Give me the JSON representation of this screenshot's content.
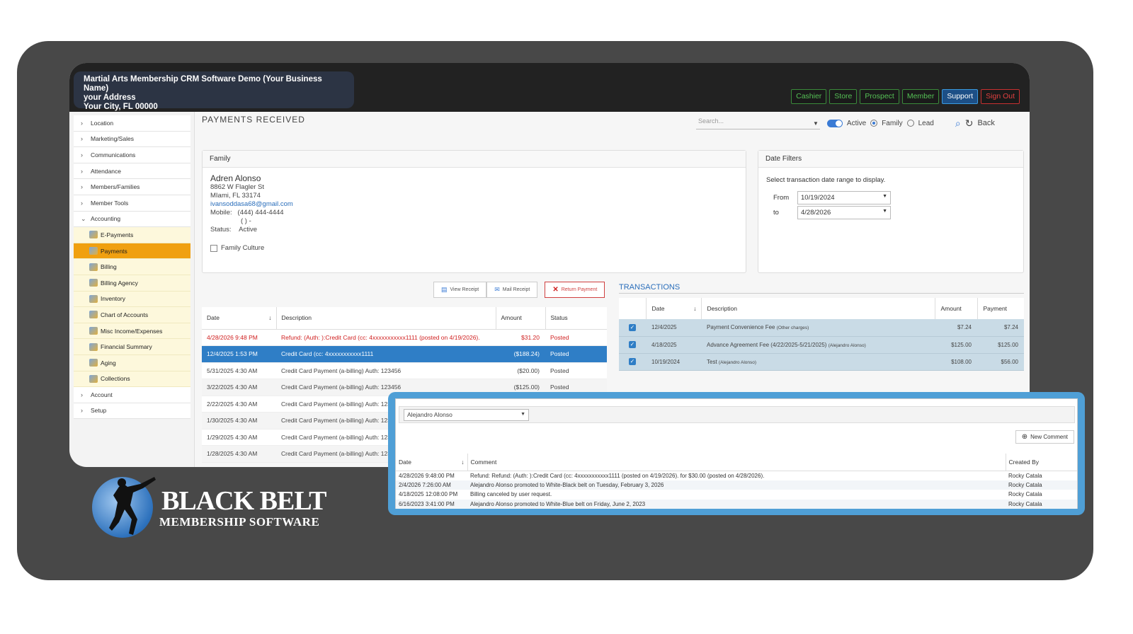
{
  "header": {
    "business_name": "Martial Arts Membership CRM Software Demo (Your Business Name)",
    "address": "your Address",
    "city": "Your City, FL 00000",
    "nav": [
      "Cashier",
      "Store",
      "Prospect",
      "Member",
      "Support",
      "Sign Out"
    ]
  },
  "sidebar": {
    "items_top": [
      "Location",
      "Marketing/Sales",
      "Communications",
      "Attendance",
      "Members/Families",
      "Member Tools",
      "Accounting"
    ],
    "accounting_sub": [
      "E-Payments",
      "Payments",
      "Billing",
      "Billing Agency",
      "Inventory",
      "Chart of Accounts",
      "Misc Income/Expenses",
      "Financial Summary",
      "Aging",
      "Collections"
    ],
    "items_bottom": [
      "Account",
      "Setup"
    ],
    "active": "Payments"
  },
  "page": {
    "title": "PAYMENTS RECEIVED",
    "search_placeholder": "Search...",
    "active_label": "Active",
    "family_label": "Family",
    "lead_label": "Lead",
    "back_label": "Back"
  },
  "family": {
    "panel_title": "Family",
    "name": "Adren Alonso",
    "street": "8862 W Flagler St",
    "city": "MIami, FL 33174",
    "email": "ivansoddasa68@gmail.com",
    "mobile_label": "Mobile:",
    "mobile": "(444) 444-4444",
    "phone2": "( ) -",
    "status_label": "Status:",
    "status": "Active",
    "family_culture": "Family Culture"
  },
  "date_filters": {
    "panel_title": "Date Filters",
    "instructions": "Select transaction date range to display.",
    "from_label": "From",
    "from": "10/19/2024",
    "to_label": "to",
    "to": "4/28/2026"
  },
  "actions": {
    "view_receipt": "View Receipt",
    "mail_receipt": "Mail Receipt",
    "return_payment": "Return Payment"
  },
  "payments": {
    "headers": [
      "Date",
      "Description",
      "Amount",
      "Status"
    ],
    "rows": [
      {
        "date": "4/28/2026 9:48 PM",
        "desc": "Refund: (Auth: ):Credit Card (cc: 4xxxxxxxxxxx1111 (posted on 4/19/2026).",
        "amount": "$31.20",
        "status": "Posted"
      },
      {
        "date": "12/4/2025 1:53 PM",
        "desc": "Credit Card (cc: 4xxxxxxxxxxx1111",
        "amount": "($188.24)",
        "status": "Posted"
      },
      {
        "date": "5/31/2025 4:30 AM",
        "desc": "Credit Card Payment (a-billing) Auth: 123456",
        "amount": "($20.00)",
        "status": "Posted"
      },
      {
        "date": "3/22/2025 4:30 AM",
        "desc": "Credit Card Payment (a-billing) Auth: 123456",
        "amount": "($125.00)",
        "status": "Posted"
      },
      {
        "date": "2/22/2025 4:30 AM",
        "desc": "Credit Card Payment (a-billing) Auth: 123",
        "amount": "",
        "status": ""
      },
      {
        "date": "1/30/2025 4:30 AM",
        "desc": "Credit Card Payment (a-billing) Auth: 123",
        "amount": "",
        "status": ""
      },
      {
        "date": "1/29/2025 4:30 AM",
        "desc": "Credit Card Payment (a-billing) Auth: 123",
        "amount": "",
        "status": ""
      },
      {
        "date": "1/28/2025 4:30 AM",
        "desc": "Credit Card Payment (a-billing) Auth: 123",
        "amount": "",
        "status": ""
      }
    ]
  },
  "transactions": {
    "title": "TRANSACTIONS",
    "headers": [
      "Date",
      "Description",
      "Amount",
      "Payment"
    ],
    "rows": [
      {
        "date": "12/4/2025",
        "desc": "Payment Convenience Fee",
        "note": "(Other charges)",
        "amount": "$7.24",
        "payment": "$7.24"
      },
      {
        "date": "4/18/2025",
        "desc": "Advance Agreement Fee (4/22/2025-5/21/2025)",
        "note": "(Alejandro Alonso)",
        "amount": "$125.00",
        "payment": "$125.00"
      },
      {
        "date": "10/19/2024",
        "desc": "Test",
        "note": "(Alejandro Alonso)",
        "amount": "$108.00",
        "payment": "$56.00"
      }
    ]
  },
  "comments": {
    "member_select": "Alejandro Alonso",
    "new_comment": "New Comment",
    "headers": [
      "Date",
      "Comment",
      "Created By"
    ],
    "rows": [
      {
        "date": "4/28/2026 9:48:00 PM",
        "comment": "Refund: Refund: (Auth: ):Credit Card (cc: 4xxxxxxxxxxx1111 (posted on 4/19/2026). for $30.00 (posted on 4/28/2026).",
        "by": "Rocky Catala"
      },
      {
        "date": "2/4/2026 7:26:00 AM",
        "comment": "Alejandro Alonso promoted to White-Black belt on Tuesday, February 3, 2026",
        "by": "Rocky Catala"
      },
      {
        "date": "4/18/2025 12:08:00 PM",
        "comment": "Billing canceled by user request.",
        "by": "Rocky Catala"
      },
      {
        "date": "6/16/2023 3:41:00 PM",
        "comment": "Alejandro Alonso promoted to White-Blue belt on Friday, June 2, 2023",
        "by": "Rocky Catala"
      }
    ]
  },
  "logo": {
    "line1": "BLACK BELT",
    "line2": "MEMBERSHIP SOFTWARE"
  }
}
